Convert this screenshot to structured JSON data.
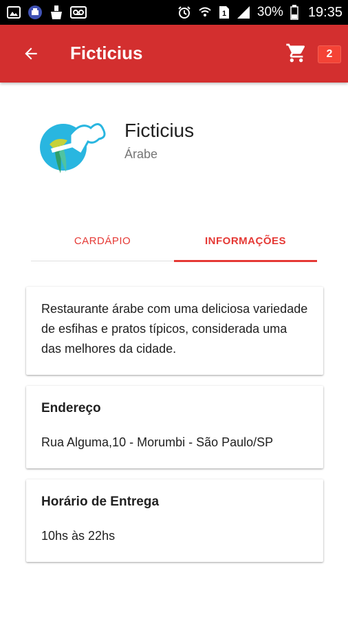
{
  "status_bar": {
    "battery": "30%",
    "time": "19:35",
    "icons_left": [
      "image-icon",
      "app-notification-icon",
      "cleaner-icon",
      "voicemail-icon"
    ],
    "icons_right": [
      "alarm-icon",
      "wifi-icon",
      "sim-icon",
      "signal-icon",
      "battery-icon"
    ]
  },
  "app_bar": {
    "title": "Ficticius",
    "cart_count": "2",
    "color": "#d32f2f"
  },
  "restaurant": {
    "name": "Ficticius",
    "category": "Árabe"
  },
  "tabs": [
    {
      "label": "CARDÁPIO",
      "active": false
    },
    {
      "label": "INFORMAÇÕES",
      "active": true
    }
  ],
  "info": {
    "description": "Restaurante árabe com uma deliciosa variedade de esfihas e pratos típicos, considerada uma das melhores da cidade.",
    "address_title": "Endereço",
    "address": "Rua Alguma,10 - Morumbi - São Paulo/SP",
    "hours_title": "Horário de Entrega",
    "hours": "10hs às 22hs"
  },
  "colors": {
    "accent": "#e53935",
    "primary": "#d32f2f"
  }
}
